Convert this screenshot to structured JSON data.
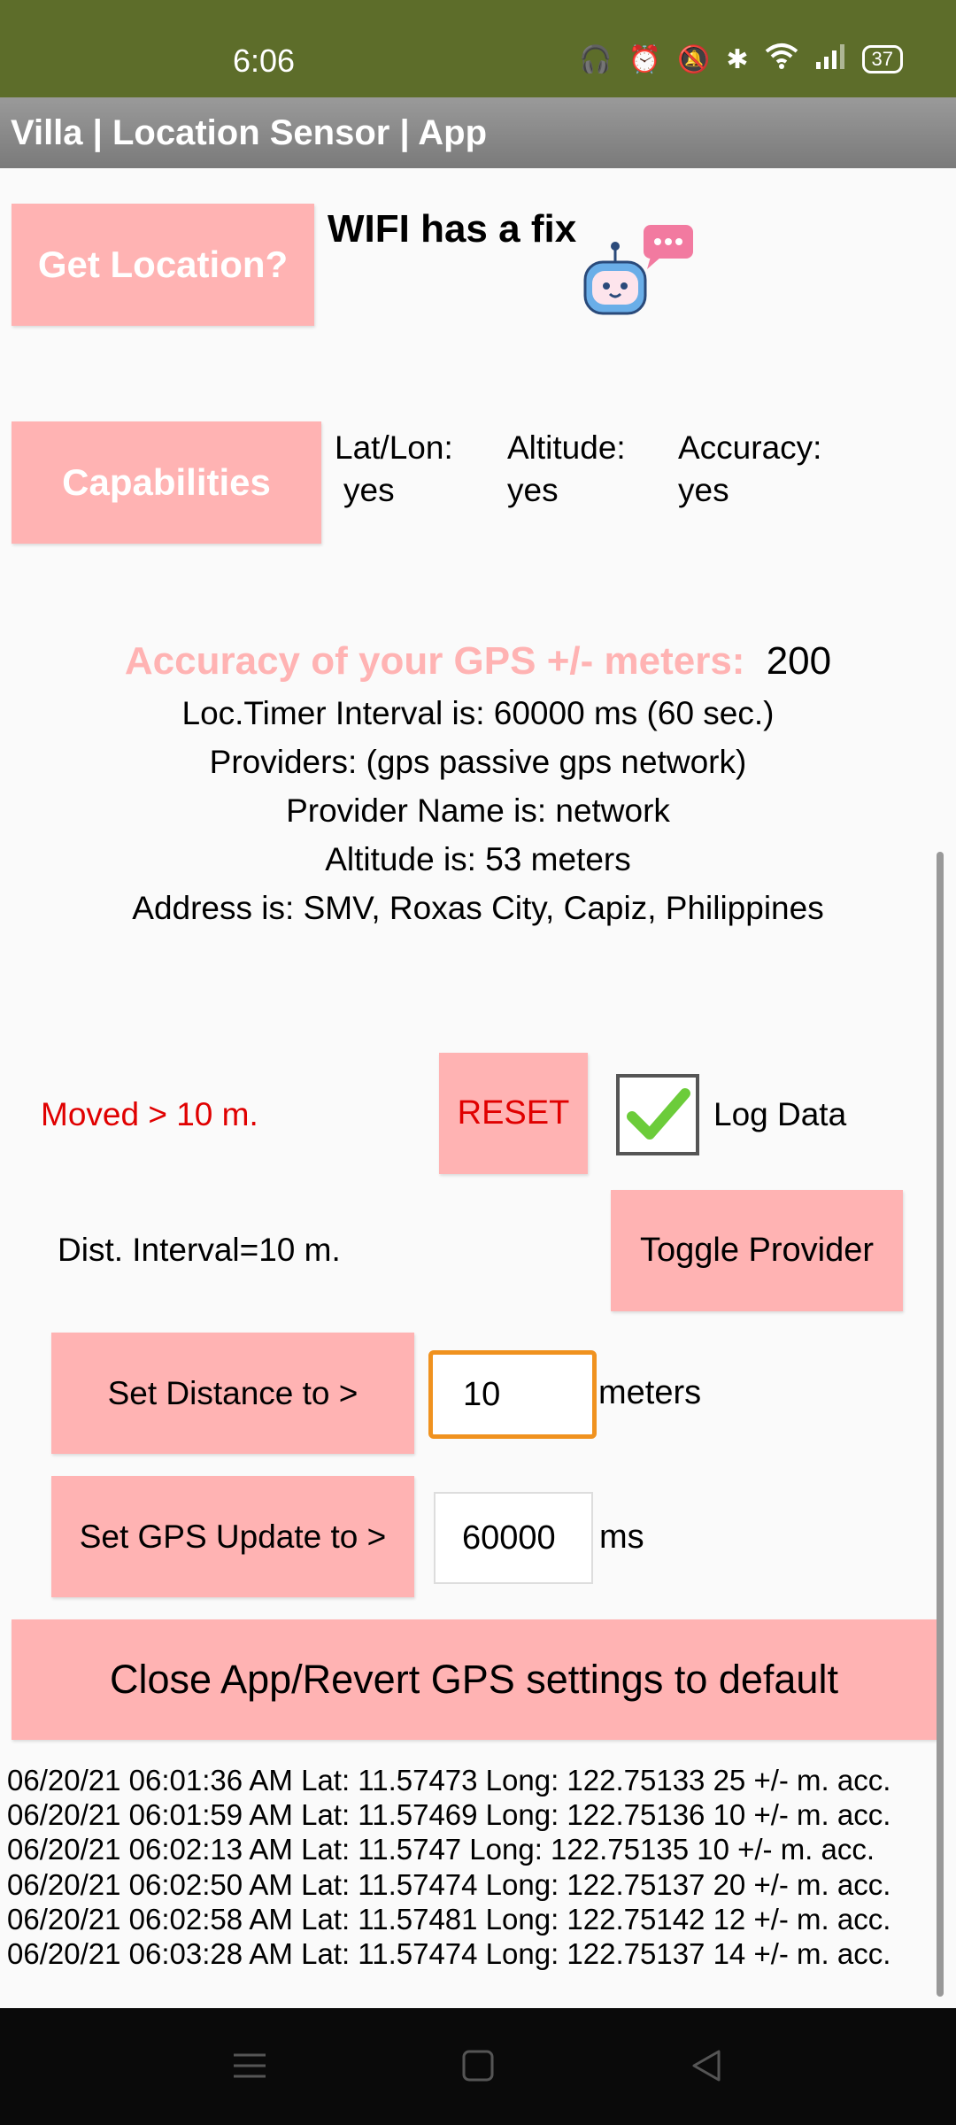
{
  "status_bar": {
    "time": "6:06",
    "icons": [
      "headphones-icon",
      "alarm-icon",
      "mute-vibrate-icon",
      "bluetooth-icon",
      "wifi-icon",
      "signal-icon"
    ],
    "battery": "37"
  },
  "app_title": "Villa | Location Sensor | App",
  "get_location": {
    "button_label": "Get Location?",
    "status": "WIFI has a fix"
  },
  "capabilities": {
    "button_label": "Capabilities",
    "items": [
      {
        "label": "Lat/Lon:",
        "value": "yes"
      },
      {
        "label": "Altitude:",
        "value": "yes"
      },
      {
        "label": "Accuracy:",
        "value": "yes"
      }
    ]
  },
  "info": {
    "accuracy_label": "Accuracy of your GPS +/- meters:",
    "accuracy_value": "200",
    "timer": "Loc.Timer Interval is:  60000 ms (60 sec.)",
    "providers": "Providers: (gps passive gps network)",
    "provider_name": "Provider Name is: network",
    "altitude": "Altitude is:  53 meters",
    "address": "Address is: SMV, Roxas City, Capiz, Philippines"
  },
  "controls": {
    "moved": "Moved > 10 m.",
    "reset_label": "RESET",
    "log_data_label": "Log Data",
    "log_data_checked": true,
    "dist_interval": "Dist. Interval=10 m.",
    "toggle_provider_label": "Toggle Provider",
    "set_distance_label": "Set Distance to >",
    "distance_value": "10",
    "distance_unit": "meters",
    "set_gps_update_label": "Set GPS Update to >",
    "gps_update_value": "60000",
    "gps_update_unit": "ms",
    "close_label": "Close App/Revert GPS settings to default"
  },
  "colors": {
    "status_bar": "#5d6d2a",
    "button_pink": "#ffb3b3",
    "accent_red": "#e00000",
    "input_focus": "#f0921f",
    "check_green": "#6ccc3a"
  },
  "log_entries": [
    "06/20/21  06:01:36 AM  Lat: 11.57473  Long: 122.75133  25 +/- m. acc.",
    "06/20/21  06:01:59 AM  Lat: 11.57469  Long: 122.75136  10 +/- m. acc.",
    "06/20/21  06:02:13 AM  Lat: 11.5747  Long: 122.75135  10 +/- m. acc.",
    "06/20/21  06:02:50 AM  Lat: 11.57474  Long: 122.75137  20 +/- m. acc.",
    "06/20/21  06:02:58 AM  Lat: 11.57481  Long: 122.75142  12 +/- m. acc.",
    "06/20/21  06:03:28 AM  Lat: 11.57474  Long: 122.75137  14 +/- m. acc."
  ],
  "nav": [
    "menu-icon",
    "home-icon",
    "back-icon"
  ]
}
